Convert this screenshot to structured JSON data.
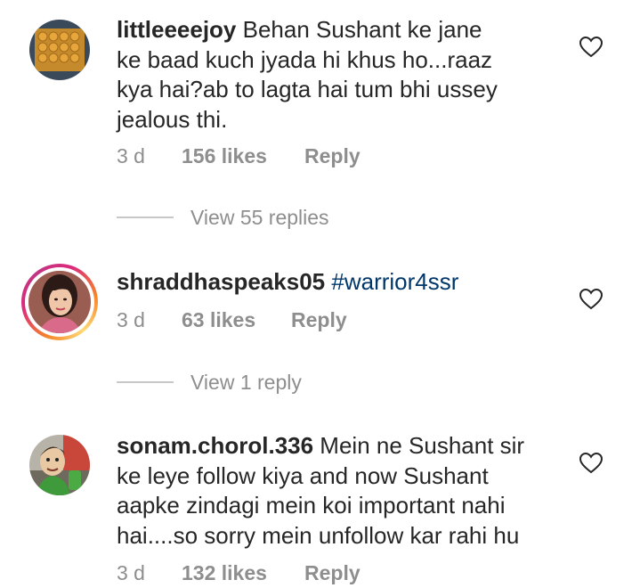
{
  "comments": [
    {
      "username": "littleeeejoy",
      "lines": [
        " Behan Sushant ke jane",
        "ke baad kuch jyada hi khus ho...raaz",
        "kya hai?ab to lagta hai tum bhi ussey",
        "jealous thi."
      ],
      "hashtag": "",
      "time": "3 d",
      "likes": "156 likes",
      "reply_label": "Reply",
      "replies_link": "View 55 replies",
      "avatar_icon": "food-tray-avatar-icon",
      "has_story_ring": false
    },
    {
      "username": "shraddhaspeaks05",
      "lines": [
        " "
      ],
      "hashtag": "#warrior4ssr",
      "time": "3 d",
      "likes": "63 likes",
      "reply_label": "Reply",
      "replies_link": "View 1 reply",
      "avatar_icon": "woman-portrait-avatar-icon",
      "has_story_ring": true
    },
    {
      "username": "sonam.chorol.336",
      "lines": [
        " Mein ne Sushant sir",
        "ke leye follow kiya  and now Sushant",
        "aapke zindagi mein koi important nahi",
        "hai....so sorry mein unfollow kar rahi hu"
      ],
      "hashtag": "",
      "time": "3 d",
      "likes": "132 likes",
      "reply_label": "Reply",
      "replies_link": "",
      "avatar_icon": "cartoon-character-avatar-icon",
      "has_story_ring": false
    }
  ],
  "colors": {
    "text": "#262626",
    "secondary": "#8e8e8e",
    "hashtag": "#00376b",
    "divider": "#c7c7c7"
  },
  "icons": {
    "like": "heart-outline-icon"
  }
}
